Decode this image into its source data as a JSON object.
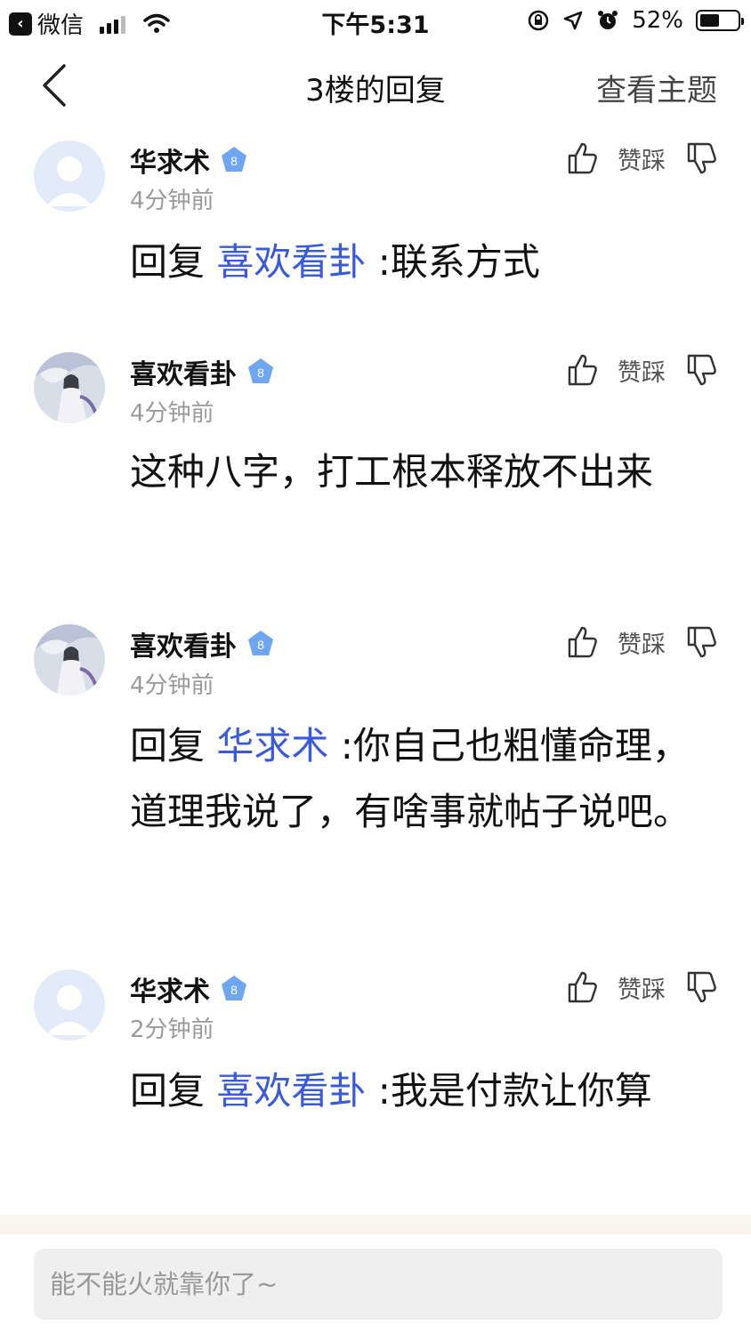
{
  "status_bar": {
    "back_app": "微信",
    "time": "下午5:31",
    "battery": "52%",
    "battery_level": 0.52
  },
  "nav": {
    "title": "3楼的回复",
    "view_topic": "查看主题"
  },
  "posts": [
    {
      "username": "华求术",
      "level": "8",
      "time": "4分钟前",
      "reply_prefix": "回复 ",
      "mention": "喜欢看卦",
      "text": " :联系方式",
      "zan_label": "赞踩"
    },
    {
      "username": "喜欢看卦",
      "level": "8",
      "time": "4分钟前",
      "reply_prefix": "",
      "mention": "",
      "text": "这种八字，打工根本释放不出来",
      "zan_label": "赞踩"
    },
    {
      "username": "喜欢看卦",
      "level": "8",
      "time": "4分钟前",
      "reply_prefix": "回复 ",
      "mention": "华求术",
      "text": " :你自己也粗懂命理，道理我说了，有啥事就帖子说吧。",
      "zan_label": "赞踩"
    },
    {
      "username": "华求术",
      "level": "8",
      "time": "2分钟前",
      "reply_prefix": "回复 ",
      "mention": "喜欢看卦",
      "text": " :我是付款让你算",
      "zan_label": "赞踩"
    }
  ],
  "reply_input": {
    "placeholder": "能不能火就靠你了~"
  },
  "colors": {
    "mention": "#3a5bd9",
    "badge": "#6ea6f0",
    "muted": "#9a9a9a"
  }
}
